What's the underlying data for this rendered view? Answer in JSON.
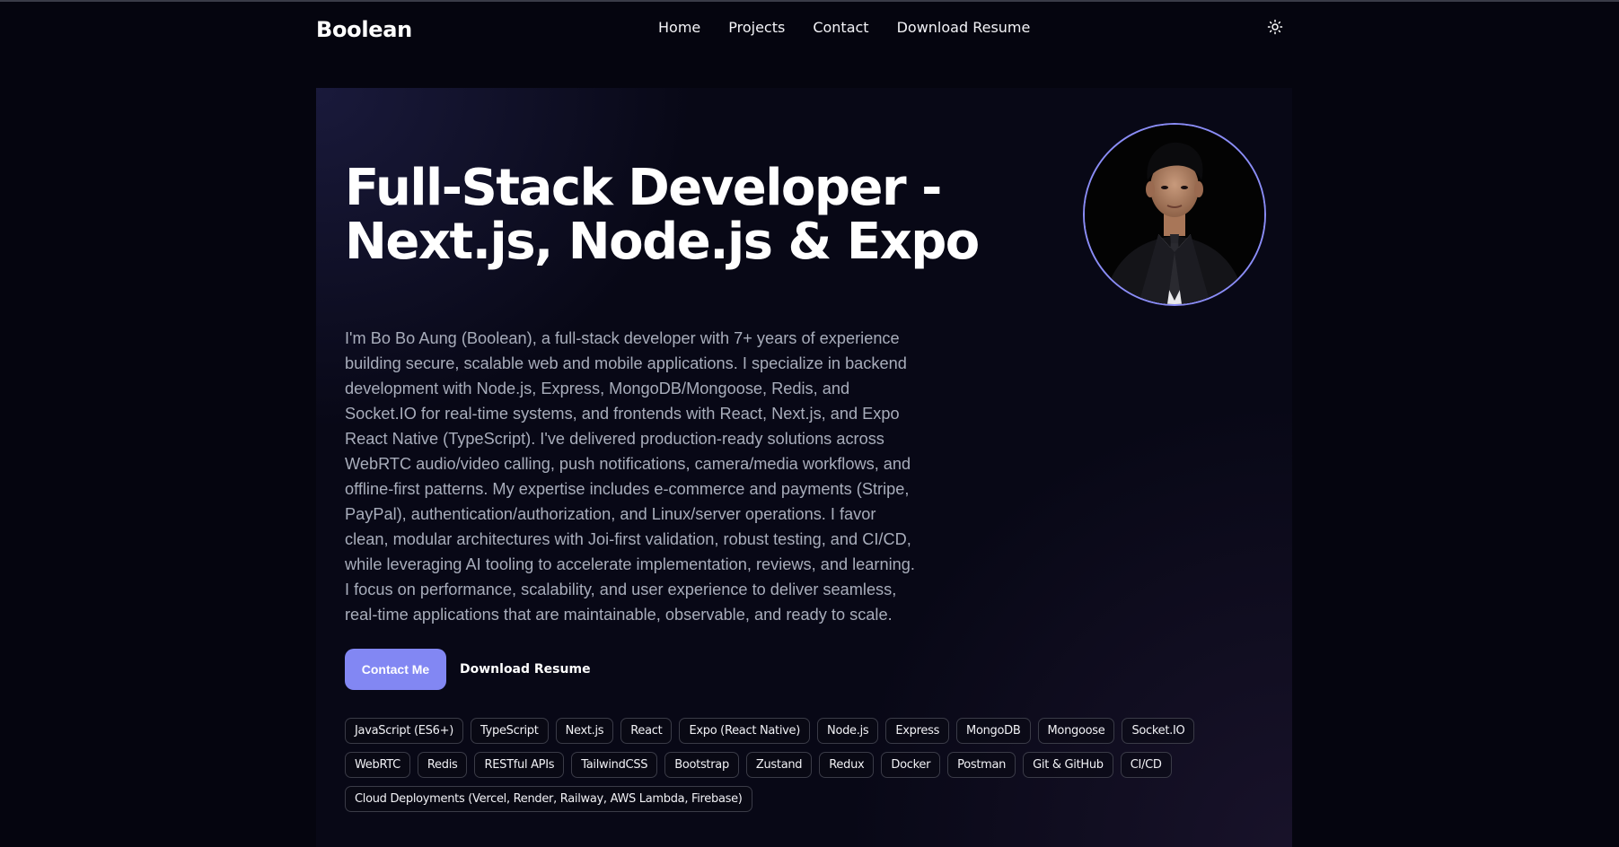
{
  "nav": {
    "brand": "Boolean",
    "links": [
      "Home",
      "Projects",
      "Contact",
      "Download Resume"
    ],
    "theme_toggle_icon": "sun-icon"
  },
  "hero": {
    "title_line1": "Full-Stack Developer -",
    "title_line2": "Next.js, Node.js & Expo",
    "bio": "I'm Bo Bo Aung (Boolean), a full-stack developer with 7+ years of experience building secure, scalable web and mobile applications. I specialize in backend development with Node.js, Express, MongoDB/Mongoose, Redis, and Socket.IO for real-time systems, and frontends with React, Next.js, and Expo React Native (TypeScript). I've delivered production-ready solutions across WebRTC audio/video calling, push notifications, camera/media workflows, and offline-first patterns. My expertise includes e-commerce and payments (Stripe, PayPal), authentication/authorization, and Linux/server operations. I favor clean, modular architectures with Joi-first validation, robust testing, and CI/CD, while leveraging AI tooling to accelerate implementation, reviews, and learning. I focus on performance, scalability, and user experience to deliver seamless, real-time applications that are maintainable, observable, and ready to scale.",
    "primary_button": "Contact Me",
    "secondary_button": "Download Resume",
    "skills": [
      "JavaScript (ES6+)",
      "TypeScript",
      "Next.js",
      "React",
      "Expo (React Native)",
      "Node.js",
      "Express",
      "MongoDB",
      "Mongoose",
      "Socket.IO",
      "WebRTC",
      "Redis",
      "RESTful APIs",
      "TailwindCSS",
      "Bootstrap",
      "Zustand",
      "Redux",
      "Docker",
      "Postman",
      "Git & GitHub",
      "CI/CD",
      "Cloud Deployments (Vercel, Render, Railway, AWS Lambda, Firebase)"
    ]
  },
  "colors": {
    "background": "#05050f",
    "accent": "#8287f3",
    "avatar_ring": "#8a8cf6",
    "body_text": "#a8adbb"
  }
}
